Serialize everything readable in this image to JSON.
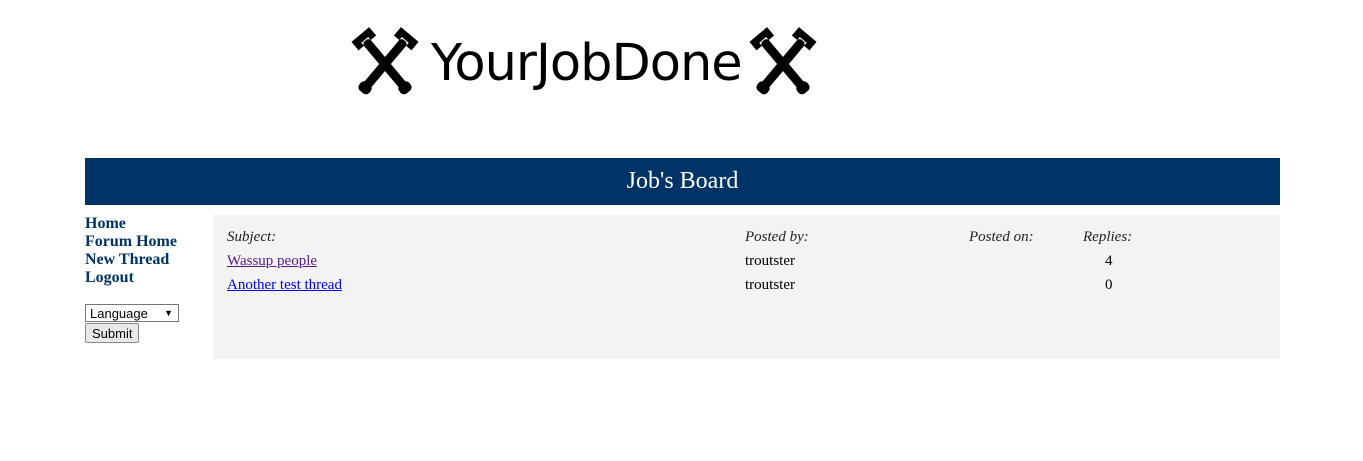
{
  "logo": {
    "text": "YourJobDone",
    "left_icon": "crossed-wrenches-icon",
    "right_icon": "crossed-wrenches-icon"
  },
  "header": {
    "title": "Job's Board",
    "background": "#003366",
    "color": "#ffffff"
  },
  "sidebar": {
    "links": [
      "Home",
      "Forum Home",
      "New Thread",
      "Logout"
    ],
    "link_color": "#003366",
    "language_select": "Language",
    "submit_label": "Submit"
  },
  "table": {
    "headers": {
      "subject": "Subject:",
      "posted_by": "Posted by:",
      "posted_on": "Posted on:",
      "replies": "Replies:"
    },
    "rows": [
      {
        "subject": "Wassup people",
        "posted_by": "troutster",
        "posted_on": "",
        "replies": "4",
        "visited": true
      },
      {
        "subject": "Another test thread",
        "posted_by": "troutster",
        "posted_on": "",
        "replies": "0",
        "visited": false
      }
    ]
  }
}
